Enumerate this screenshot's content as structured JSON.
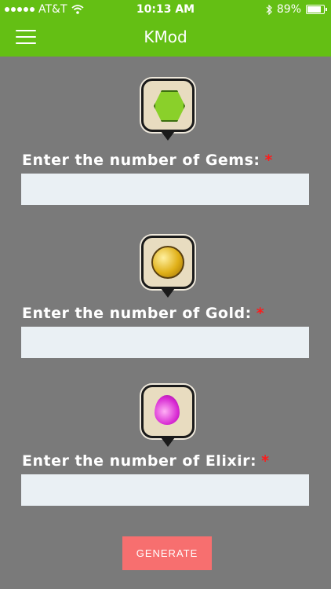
{
  "status_bar": {
    "carrier": "AT&T",
    "time": "10:13 AM",
    "battery_percent": "89%",
    "battery_level": 0.89,
    "signal_bars": 5,
    "icons": [
      "signal-dots-icon",
      "wifi-icon",
      "bluetooth-icon",
      "battery-icon"
    ]
  },
  "app_bar": {
    "title": "KMod",
    "menu_icon": "hamburger-menu-icon",
    "color": "#64bf14"
  },
  "form": {
    "gems": {
      "label": "Enter the number of Gems:",
      "required": "*",
      "value": "",
      "icon": "gem-icon"
    },
    "gold": {
      "label": "Enter the number of Gold:",
      "required": "*",
      "value": "",
      "icon": "gold-coin-icon"
    },
    "elixir": {
      "label": "Enter the number of Elixir:",
      "required": "*",
      "value": "",
      "icon": "elixir-drop-icon"
    },
    "generate_label": "GENERATE"
  },
  "colors": {
    "background": "#7a7a7a",
    "accent": "#64bf14",
    "required": "#ff1a1a",
    "button": "#f76f6f",
    "input_bg": "#eaf0f4"
  }
}
